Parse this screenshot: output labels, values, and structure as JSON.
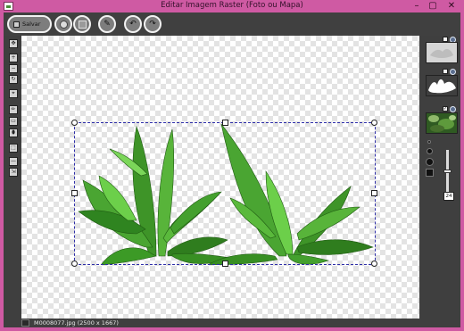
{
  "window": {
    "title": "Editar Imagem Raster (Foto ou Mapa)",
    "minimize": "–",
    "maximize": "▢",
    "close": "✕"
  },
  "toolbar": {
    "save_label": "Salvar",
    "undo_glyph": "↶",
    "redo_glyph": "↷",
    "magic_glyph": "✎"
  },
  "left_tools": [
    {
      "name": "move-tool-icon",
      "glyph": "✥"
    },
    {
      "name": "zoom-in-tool-icon",
      "glyph": "+"
    },
    {
      "name": "zoom-out-tool-icon",
      "glyph": "−"
    },
    {
      "name": "rotate-tool-icon",
      "glyph": "↻"
    },
    {
      "name": "crop-tool-icon",
      "glyph": "⌖"
    },
    {
      "name": "pencil-tool-icon",
      "glyph": "✏"
    },
    {
      "name": "eraser-tool-icon",
      "glyph": "▭"
    },
    {
      "name": "brush-tool-icon",
      "glyph": "⬮"
    },
    {
      "name": "select-tool-icon",
      "glyph": "⬚"
    },
    {
      "name": "line-tool-icon",
      "glyph": "—"
    },
    {
      "name": "export-tool-icon",
      "glyph": "⇲"
    }
  ],
  "layers": [
    {
      "name": "layer-mask-gray",
      "checked": false
    },
    {
      "name": "layer-silhouette",
      "checked": false
    },
    {
      "name": "layer-photo",
      "checked": true
    }
  ],
  "brush": {
    "size": "24"
  },
  "status": {
    "file_info": "M0008077.jpg (2500 x 1667)"
  },
  "colors": {
    "frame": "#cf5aa3",
    "panel": "#3f3f3f",
    "selection": "#2d2da8",
    "leaf_dark": "#2f7d1e",
    "leaf_light": "#6ccf4a"
  }
}
